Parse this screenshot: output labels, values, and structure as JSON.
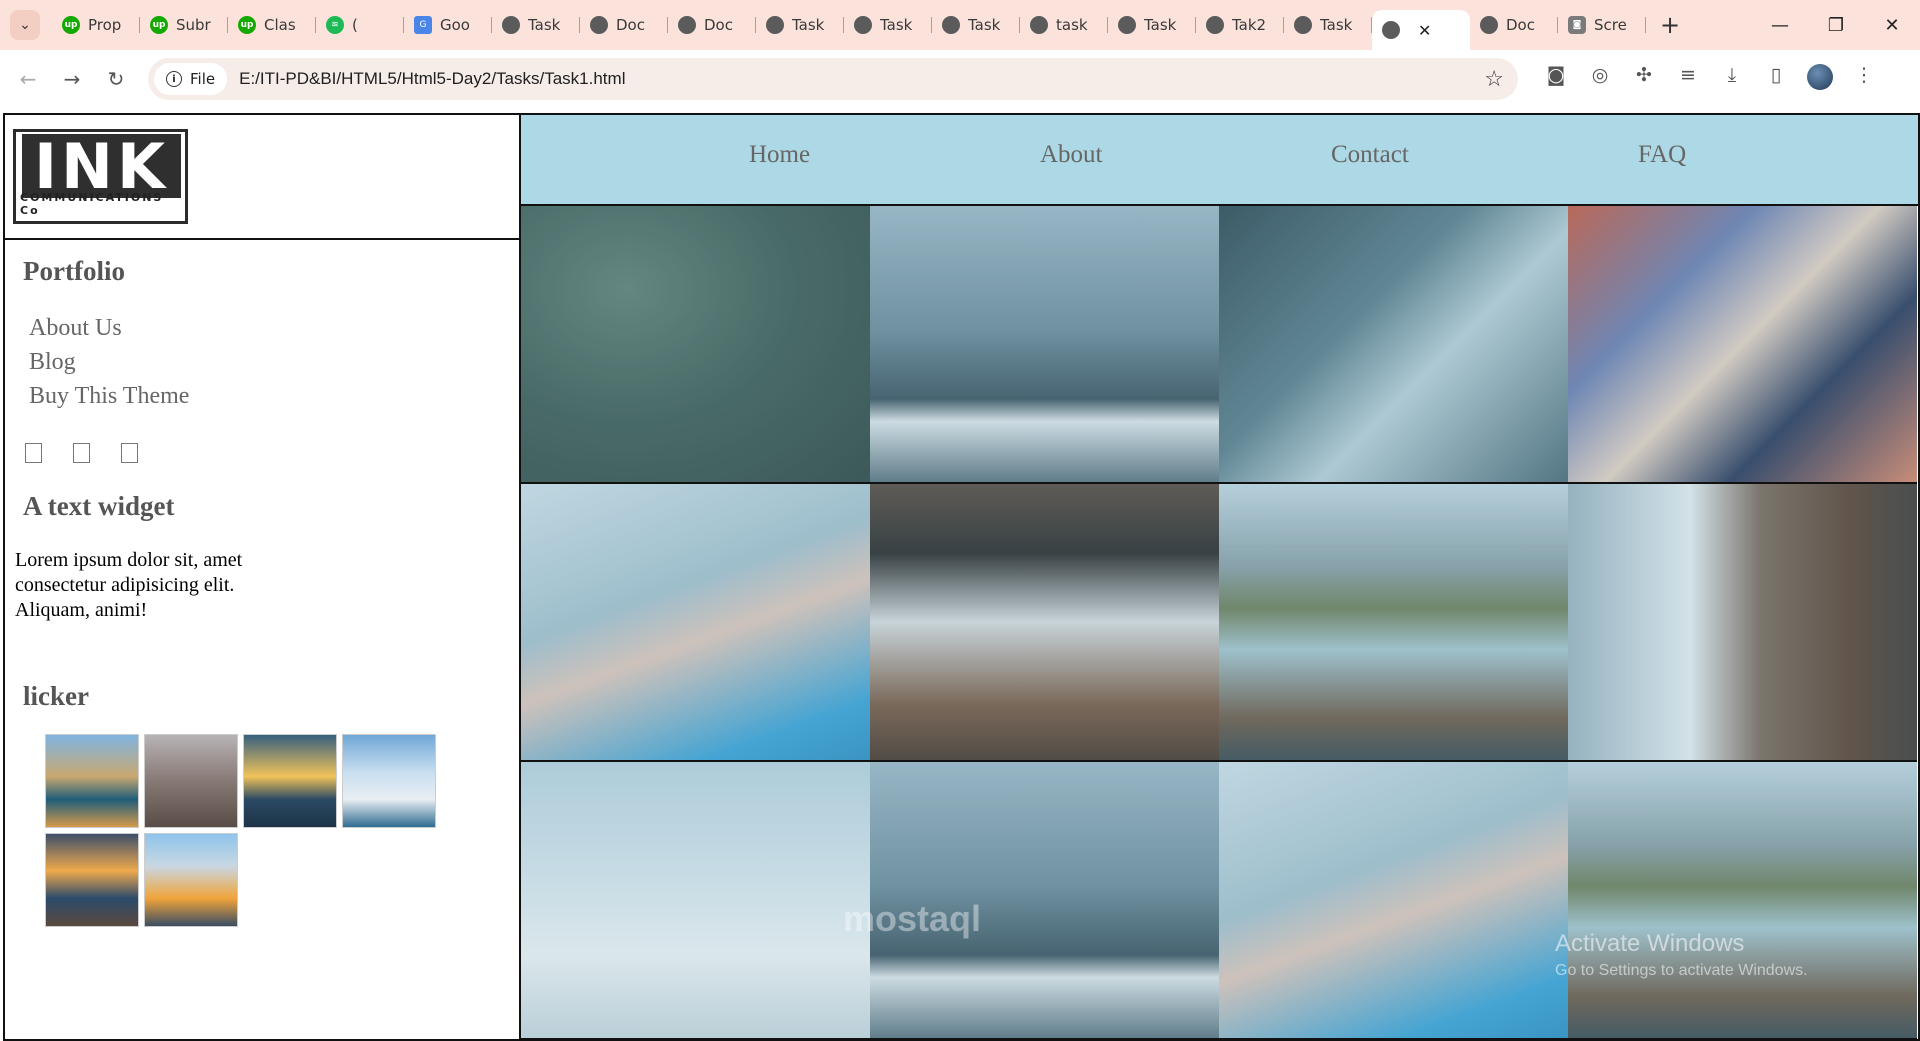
{
  "browser": {
    "tabs": [
      {
        "title": "Prop",
        "icon": "upwork-icon"
      },
      {
        "title": "Subr",
        "icon": "upwork-icon"
      },
      {
        "title": "Clas",
        "icon": "upwork-icon"
      },
      {
        "title": "(",
        "icon": "spotify-icon"
      },
      {
        "title": "Goo",
        "icon": "translate-icon"
      },
      {
        "title": "Task",
        "icon": "globe-icon"
      },
      {
        "title": "Doc",
        "icon": "globe-icon"
      },
      {
        "title": "Doc",
        "icon": "globe-icon"
      },
      {
        "title": "Task",
        "icon": "globe-icon"
      },
      {
        "title": "Task",
        "icon": "globe-icon"
      },
      {
        "title": "Task",
        "icon": "globe-icon"
      },
      {
        "title": "task",
        "icon": "globe-icon"
      },
      {
        "title": "Task",
        "icon": "globe-icon"
      },
      {
        "title": "Tak2",
        "icon": "globe-icon"
      },
      {
        "title": "Task",
        "icon": "globe-icon"
      },
      {
        "title": "",
        "icon": "globe-icon",
        "active": true
      },
      {
        "title": "Doc",
        "icon": "globe-icon"
      },
      {
        "title": "Scre",
        "icon": "camera-icon"
      }
    ],
    "address": {
      "chip_label": "File",
      "url": "E:/ITI-PD&BI/HTML5/Html5-Day2/Tasks/Task1.html"
    },
    "colors": {
      "tabstrip": "#fbe3db",
      "omnibox": "#f6ede9"
    }
  },
  "page": {
    "logo": {
      "word": "INK",
      "tagline": "COMMUNICATIONS Co"
    },
    "sidebar": {
      "portfolio_heading": "Portfolio",
      "links": [
        "About Us",
        "Blog",
        "Buy This Theme"
      ],
      "widget_heading": "A text widget",
      "widget_text": "Lorem ipsum dolor sit, amet consectetur adipisicing elit. Aliquam, animi!",
      "flicker_heading": "licker"
    },
    "nav": [
      "Home",
      "About",
      "Contact",
      "FAQ"
    ],
    "nav_bg": "#add8e6",
    "gallery": [
      "palm-leaves",
      "desk-keyboard",
      "glass-buildings",
      "phone-graffiti",
      "smartwatch-hand",
      "laptop-typing",
      "lake-mountains",
      "waterfall-cliff",
      "city-fog",
      "desk-keyboard",
      "smartwatch-hand",
      "lake-dock"
    ]
  },
  "overlay": {
    "activate_title": "Activate Windows",
    "activate_sub": "Go to Settings to activate Windows.",
    "watermark": "mostaql"
  }
}
